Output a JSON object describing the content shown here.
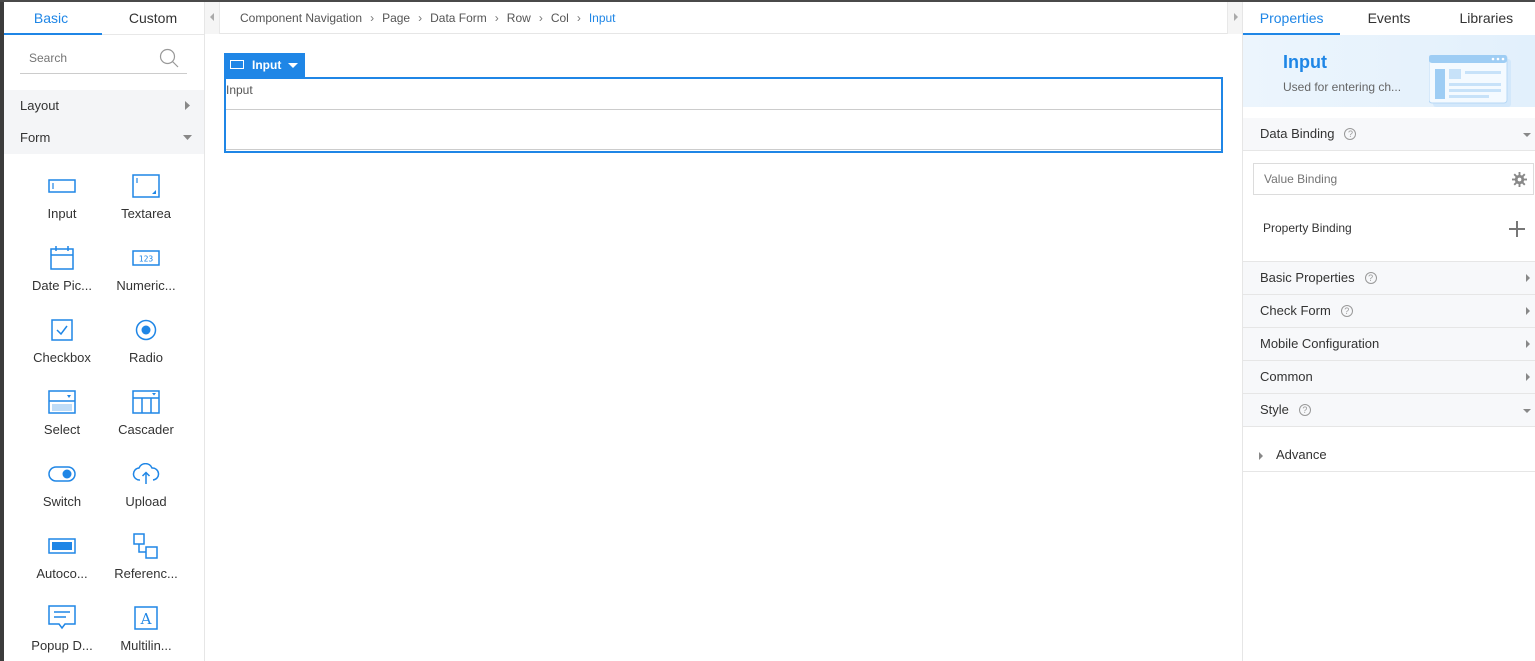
{
  "left_panel": {
    "tabs": [
      "Basic",
      "Custom"
    ],
    "search_placeholder": "Search",
    "groups": {
      "layout": "Layout",
      "form": "Form"
    },
    "components": [
      {
        "label": "Input",
        "icon": "input-icon"
      },
      {
        "label": "Textarea",
        "icon": "textarea-icon"
      },
      {
        "label": "Date Pic...",
        "icon": "calendar-icon"
      },
      {
        "label": "Numeric...",
        "icon": "numeric-icon"
      },
      {
        "label": "Checkbox",
        "icon": "checkbox-icon"
      },
      {
        "label": "Radio",
        "icon": "radio-icon"
      },
      {
        "label": "Select",
        "icon": "select-icon"
      },
      {
        "label": "Cascader",
        "icon": "cascader-icon"
      },
      {
        "label": "Switch",
        "icon": "switch-icon"
      },
      {
        "label": "Upload",
        "icon": "upload-icon"
      },
      {
        "label": "Autoco...",
        "icon": "autocomplete-icon"
      },
      {
        "label": "Referenc...",
        "icon": "reference-icon"
      },
      {
        "label": "Popup D...",
        "icon": "popup-dialog-icon"
      },
      {
        "label": "Multilin...",
        "icon": "multilingual-icon"
      }
    ]
  },
  "breadcrumb": [
    "Component Navigation",
    "Page",
    "Data Form",
    "Row",
    "Col",
    "Input"
  ],
  "canvas": {
    "selected_tag": "Input",
    "field_label": "Input"
  },
  "right_panel": {
    "tabs": [
      "Properties",
      "Events",
      "Libraries"
    ],
    "banner": {
      "title": "Input",
      "desc": "Used for entering ch..."
    },
    "sections": {
      "data_binding": "Data Binding",
      "basic_properties": "Basic Properties",
      "check_form": "Check Form",
      "mobile_configuration": "Mobile Configuration",
      "common": "Common",
      "style": "Style"
    },
    "value_binding_placeholder": "Value Binding",
    "property_binding": "Property Binding",
    "advance": "Advance",
    "help_glyph": "?"
  },
  "colors": {
    "accent": "#1f86e6"
  }
}
